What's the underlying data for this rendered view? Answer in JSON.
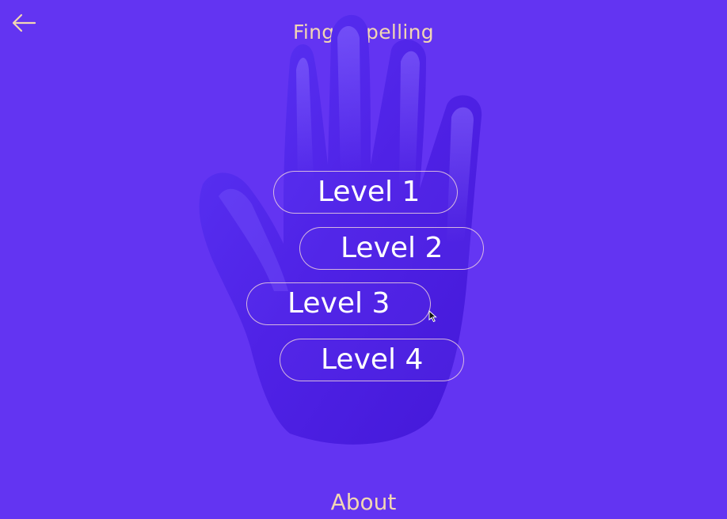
{
  "header": {
    "title": "Fingerspelling",
    "back_icon": "arrow-left-icon"
  },
  "levels": [
    {
      "label": "Level 1"
    },
    {
      "label": "Level 2"
    },
    {
      "label": "Level 3"
    },
    {
      "label": "Level 4"
    }
  ],
  "footer": {
    "about_label": "About"
  },
  "theme": {
    "background": "#6334f2",
    "accent_text": "#f2d6b3",
    "button_text": "#ffffff",
    "button_border": "#ffe6dc"
  },
  "decor": {
    "illustration": "hand-illustration"
  }
}
